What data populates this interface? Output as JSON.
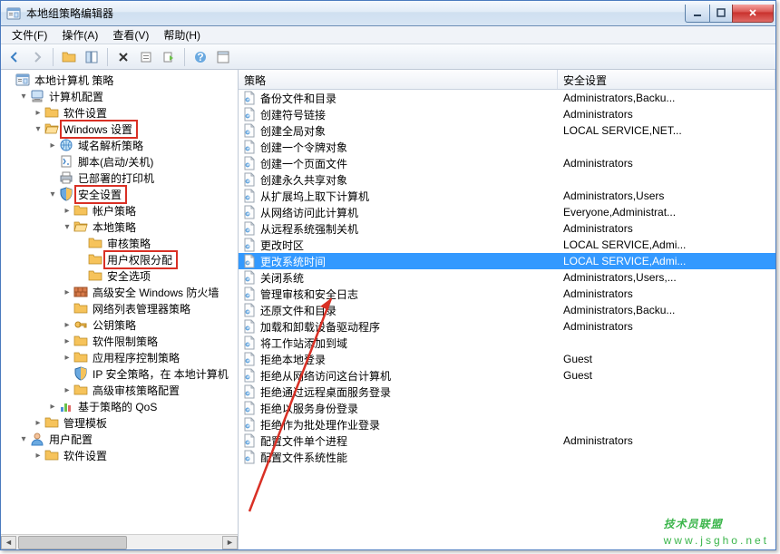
{
  "window": {
    "title": "本地组策略编辑器"
  },
  "menu": {
    "file": "文件(F)",
    "action": "操作(A)",
    "view": "查看(V)",
    "help": "帮助(H)"
  },
  "tree": {
    "root": "本地计算机 策略",
    "computer_config": "计算机配置",
    "software_settings": "软件设置",
    "windows_settings": "Windows 设置",
    "dns_policy": "域名解析策略",
    "scripts": "脚本(启动/关机)",
    "printers": "已部署的打印机",
    "security_settings": "安全设置",
    "account_policies": "帐户策略",
    "local_policies": "本地策略",
    "audit_policy": "审核策略",
    "user_rights": "用户权限分配",
    "security_options": "安全选项",
    "adv_firewall": "高级安全 Windows 防火墙",
    "net_list_mgr": "网络列表管理器策略",
    "public_key": "公钥策略",
    "software_restrict": "软件限制策略",
    "app_control": "应用程序控制策略",
    "ipsec": "IP 安全策略，在 本地计算机",
    "adv_audit": "高级审核策略配置",
    "qos": "基于策略的 QoS",
    "admin_templates": "管理模板",
    "user_config": "用户配置",
    "user_software": "软件设置"
  },
  "list": {
    "header_name": "策略",
    "header_sec": "安全设置",
    "rows": [
      {
        "name": "备份文件和目录",
        "sec": "Administrators,Backu..."
      },
      {
        "name": "创建符号链接",
        "sec": "Administrators"
      },
      {
        "name": "创建全局对象",
        "sec": "LOCAL SERVICE,NET..."
      },
      {
        "name": "创建一个令牌对象",
        "sec": ""
      },
      {
        "name": "创建一个页面文件",
        "sec": "Administrators"
      },
      {
        "name": "创建永久共享对象",
        "sec": ""
      },
      {
        "name": "从扩展坞上取下计算机",
        "sec": "Administrators,Users"
      },
      {
        "name": "从网络访问此计算机",
        "sec": "Everyone,Administrat..."
      },
      {
        "name": "从远程系统强制关机",
        "sec": "Administrators"
      },
      {
        "name": "更改时区",
        "sec": "LOCAL SERVICE,Admi..."
      },
      {
        "name": "更改系统时间",
        "sec": "LOCAL SERVICE,Admi...",
        "selected": true
      },
      {
        "name": "关闭系统",
        "sec": "Administrators,Users,..."
      },
      {
        "name": "管理审核和安全日志",
        "sec": "Administrators"
      },
      {
        "name": "还原文件和目录",
        "sec": "Administrators,Backu..."
      },
      {
        "name": "加载和卸载设备驱动程序",
        "sec": "Administrators"
      },
      {
        "name": "将工作站添加到域",
        "sec": ""
      },
      {
        "name": "拒绝本地登录",
        "sec": "Guest"
      },
      {
        "name": "拒绝从网络访问这台计算机",
        "sec": "Guest"
      },
      {
        "name": "拒绝通过远程桌面服务登录",
        "sec": ""
      },
      {
        "name": "拒绝以服务身份登录",
        "sec": ""
      },
      {
        "name": "拒绝作为批处理作业登录",
        "sec": ""
      },
      {
        "name": "配置文件单个进程",
        "sec": "Administrators"
      },
      {
        "name": "配置文件系统性能",
        "sec": ""
      }
    ]
  },
  "watermark": {
    "main": "技术员联盟",
    "sub": "www.jsgho.net"
  }
}
